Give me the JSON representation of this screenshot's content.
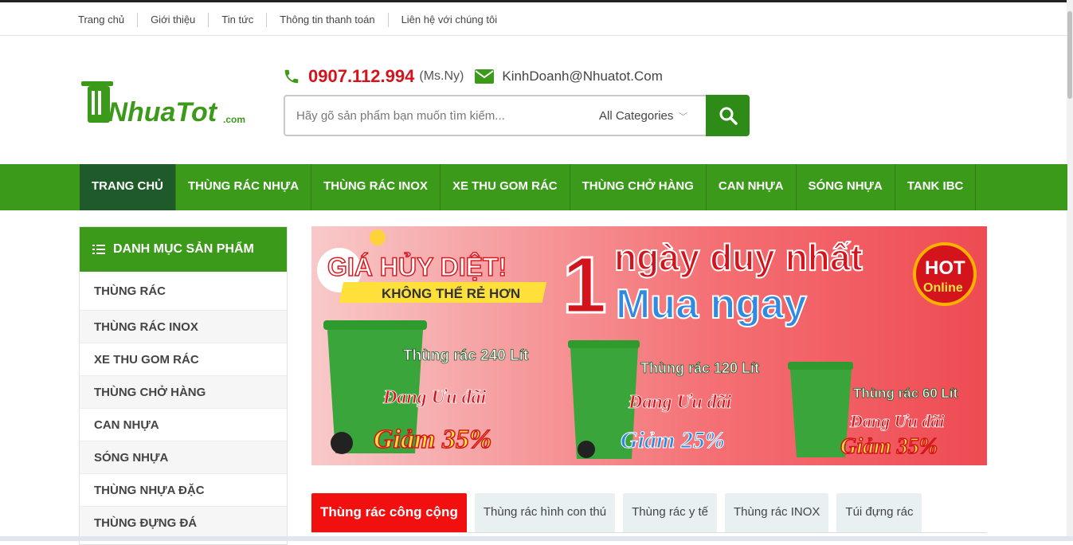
{
  "topnav": [
    "Trang chủ",
    "Giới thiệu",
    "Tin tức",
    "Thông tin thanh toán",
    "Liên hệ với chúng tôi"
  ],
  "logo": {
    "text": ".NhuaTot",
    "suffix": ".com"
  },
  "contact": {
    "phone": "0907.112.994",
    "phone_note": "(Ms.Ny)",
    "email": "KinhDoanh@Nhuatot.Com"
  },
  "search": {
    "placeholder": "Hãy gõ sản phẩm bạn muốn tìm kiếm...",
    "category": "All Categories"
  },
  "mainnav": [
    "TRANG CHỦ",
    "THÙNG RÁC NHỰA",
    "THÙNG RÁC INOX",
    "XE THU GOM RÁC",
    "THÙNG CHỞ HÀNG",
    "CAN NHỰA",
    "SÓNG NHỰA",
    "TANK IBC"
  ],
  "sidebar": {
    "title": "DANH MỤC SẢN PHẨM",
    "items": [
      "THÙNG RÁC",
      "THÙNG RÁC INOX",
      "XE THU GOM RÁC",
      "THÙNG CHỞ HÀNG",
      "CAN NHỰA",
      "SÓNG NHỰA",
      "THÙNG NHỰA ĐẶC",
      "THÙNG ĐỰNG ĐÁ"
    ]
  },
  "banner": {
    "headline1": "GIÁ HỦY DIỆT!",
    "headline2": "KHÔNG THỂ RẺ HƠN",
    "big_number": "1",
    "line1": "ngày duy nhất",
    "line2": "Mua ngay",
    "hot": "HOT",
    "online": "Online",
    "products": [
      {
        "name": "Thùng rác 240 Lít",
        "promo": "Đang Ưu đãi",
        "discount": "Giảm 35%"
      },
      {
        "name": "Thùng rác 120 Lít",
        "promo": "Đang Ưu đãi",
        "discount": "Giảm 25%"
      },
      {
        "name": "Thùng rác 60 Lít",
        "promo": "Đang Ưu đãi",
        "discount": "Giảm 35%"
      }
    ]
  },
  "tabs": [
    "Thùng rác công cộng",
    "Thùng rác hình con thú",
    "Thùng rác y tế",
    "Thùng rác INOX",
    "Túi đựng rác"
  ],
  "colors": {
    "green": "#3c9a1a",
    "dark_green": "#1f5a2a",
    "red": "#d4141c",
    "tab_active": "#f20f0f"
  }
}
